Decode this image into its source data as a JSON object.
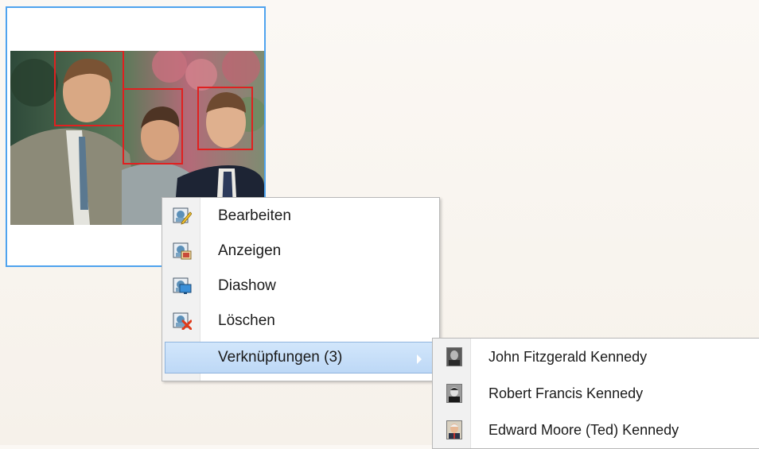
{
  "context_menu": {
    "items": [
      {
        "label": "Bearbeiten",
        "icon": "edit-photo-icon"
      },
      {
        "label": "Anzeigen",
        "icon": "view-photo-icon"
      },
      {
        "label": "Diashow",
        "icon": "slideshow-icon"
      },
      {
        "label": "Löschen",
        "icon": "delete-photo-icon"
      },
      {
        "label": "Verknüpfungen (3)",
        "icon": "",
        "has_submenu": true,
        "selected": true
      }
    ]
  },
  "submenu": {
    "items": [
      {
        "label": "John Fitzgerald Kennedy",
        "icon": "person-thumbnail"
      },
      {
        "label": "Robert Francis Kennedy",
        "icon": "person-thumbnail"
      },
      {
        "label": "Edward Moore (Ted) Kennedy",
        "icon": "person-thumbnail"
      }
    ]
  },
  "colors": {
    "selection_border": "#4fa3ee",
    "face_box": "#e02020",
    "menu_highlight": "#c7dff8"
  }
}
